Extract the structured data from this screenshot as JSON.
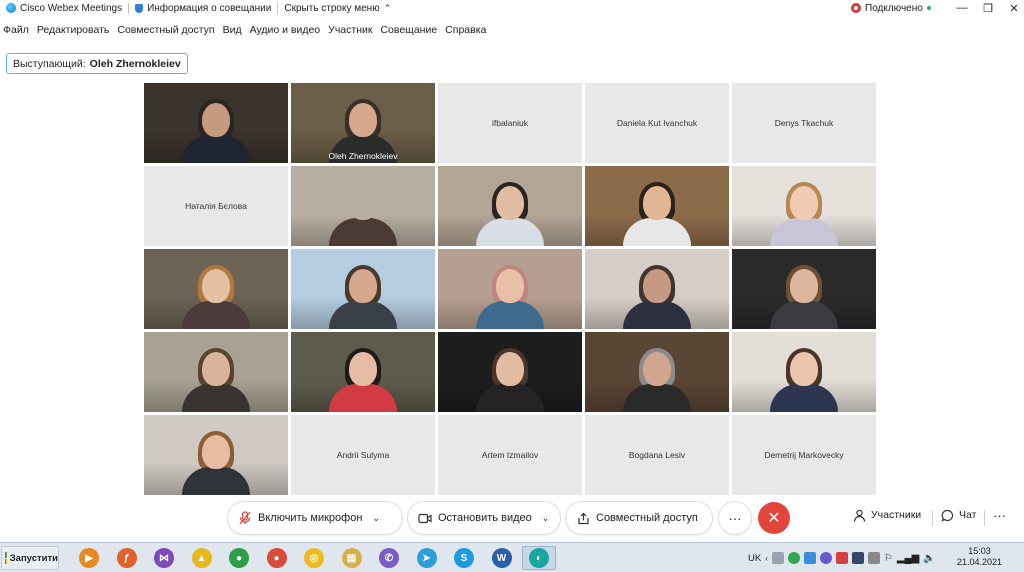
{
  "titlebar": {
    "app_name": "Cisco Webex Meetings",
    "meeting_info": "Информация о совещании",
    "hide_menu": "Скрыть строку меню",
    "status": "Подключено"
  },
  "menu": [
    "Файл",
    "Редактировать",
    "Совместный доступ",
    "Вид",
    "Аудио и видео",
    "Участник",
    "Совещание",
    "Справка"
  ],
  "speaker": {
    "label": "Выступающий:",
    "name": "Oleh Zhernokleiev"
  },
  "tiles": [
    {
      "name": "",
      "video": true,
      "bg": "#3b342c",
      "skin": "#c59a7e",
      "hair": "#2a2520",
      "body": "#1f2530"
    },
    {
      "name": "Oleh Zhernokleiev",
      "video": true,
      "active": true,
      "bg": "#6b5e48",
      "skin": "#d7a88e",
      "hair": "#3a2f27",
      "body": "#2b2b2b"
    },
    {
      "name": "ifbalaniuk",
      "video": false
    },
    {
      "name": "Daniela Kut Ivanchuk",
      "video": false
    },
    {
      "name": "Denys Tkachuk",
      "video": false
    },
    {
      "name": "Наталія Бєлова",
      "video": false
    },
    {
      "name": "",
      "video": true,
      "bg": "#b8aea2",
      "skin": "#b8aea2",
      "hair": "#b8aea2",
      "body": "#4a3a33"
    },
    {
      "name": "",
      "video": true,
      "bg": "#b3a596",
      "skin": "#e0bca3",
      "hair": "#2a2320",
      "body": "#d8dde6"
    },
    {
      "name": "",
      "video": true,
      "bg": "#8c6b4a",
      "skin": "#e2b594",
      "hair": "#2a221c",
      "body": "#e7e7e7"
    },
    {
      "name": "",
      "video": true,
      "bg": "#e7e1dc",
      "skin": "#f0cbb2",
      "hair": "#b88752",
      "body": "#c8c5d6"
    },
    {
      "name": "",
      "video": true,
      "bg": "#6d6355",
      "skin": "#e4bfa2",
      "hair": "#b07a3e",
      "body": "#4a3b3a"
    },
    {
      "name": "",
      "video": true,
      "bg": "#b4cde0",
      "skin": "#d6a98e",
      "hair": "#4a3a2c",
      "body": "#394048"
    },
    {
      "name": "",
      "video": true,
      "bg": "#b59f90",
      "skin": "#e8c0a8",
      "hair": "#c0867e",
      "body": "#3e6a8e"
    },
    {
      "name": "",
      "video": true,
      "bg": "#d6cec6",
      "skin": "#c69a82",
      "hair": "#403530",
      "body": "#2c2f3d"
    },
    {
      "name": "",
      "video": true,
      "bg": "#2b2b2b",
      "skin": "#dcb79e",
      "hair": "#6e5132",
      "body": "#3c3c40"
    },
    {
      "name": "",
      "video": true,
      "bg": "#a8a194",
      "skin": "#d9b39a",
      "hair": "#5a4230",
      "body": "#3a3430"
    },
    {
      "name": "",
      "video": true,
      "bg": "#5d5b4b",
      "skin": "#e4bca4",
      "hair": "#1f1a17",
      "body": "#d33b44"
    },
    {
      "name": "",
      "video": true,
      "bg": "#1d1d1d",
      "skin": "#e2bba3",
      "hair": "#4b3529",
      "body": "#262326"
    },
    {
      "name": "",
      "video": true,
      "bg": "#5a4634",
      "skin": "#cfa58d",
      "hair": "#8a8a8a",
      "body": "#2a2a2a"
    },
    {
      "name": "",
      "video": true,
      "bg": "#e3ded6",
      "skin": "#e9c6ad",
      "hair": "#4a3428",
      "body": "#2d3650"
    },
    {
      "name": "",
      "video": true,
      "bg": "#cfc9c2",
      "skin": "#e6bca0",
      "hair": "#8a5f38",
      "body": "#30323a"
    },
    {
      "name": "Andrii Sulyma",
      "video": false
    },
    {
      "name": "Artem Izmailov",
      "video": false
    },
    {
      "name": "Bogdana Lesiv",
      "video": false
    },
    {
      "name": "Demetrij Markovecky",
      "video": false
    }
  ],
  "controls": {
    "mic": "Включить микрофон",
    "video": "Остановить видео",
    "share": "Совместный доступ",
    "more": "···",
    "participants": "Участники",
    "chat": "Чат",
    "overflow": "···"
  },
  "taskbar": {
    "start": "Запустити",
    "lang": "UK",
    "time": "15:03",
    "date": "21.04.2021",
    "apps": [
      {
        "name": "media-player-icon",
        "color": "#e68a1f",
        "glyph": "▶"
      },
      {
        "name": "firefox-icon",
        "color": "#e2612a",
        "glyph": "ƒ"
      },
      {
        "name": "visual-studio-icon",
        "color": "#7b4bb8",
        "glyph": "⋈"
      },
      {
        "name": "archicad-icon",
        "color": "#e8b820",
        "glyph": "▲"
      },
      {
        "name": "chrome-icon",
        "color": "#2e9e48",
        "glyph": "●"
      },
      {
        "name": "chrome-profile-icon",
        "color": "#d94b3a",
        "glyph": "●"
      },
      {
        "name": "yandex-browser-icon",
        "color": "#f0b923",
        "glyph": "◎"
      },
      {
        "name": "file-explorer-icon",
        "color": "#d7b24a",
        "glyph": "▤"
      },
      {
        "name": "viber-icon",
        "color": "#7a5bc7",
        "glyph": "✆"
      },
      {
        "name": "telegram-icon",
        "color": "#2c9fd9",
        "glyph": "➤"
      },
      {
        "name": "skype-icon",
        "color": "#1d9be0",
        "glyph": "S"
      },
      {
        "name": "word-icon",
        "color": "#2b5faa",
        "glyph": "W"
      },
      {
        "name": "webex-taskbar-icon",
        "color": "#17a7a0",
        "glyph": "◐"
      }
    ]
  }
}
